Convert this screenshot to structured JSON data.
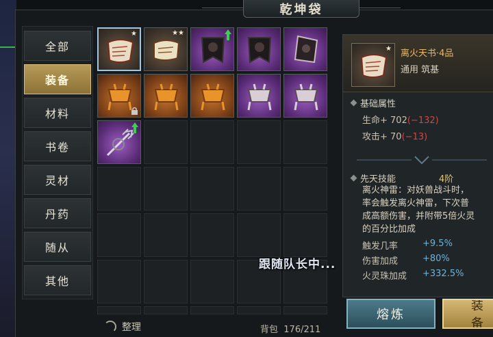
{
  "window": {
    "title": "乾坤袋"
  },
  "categories": [
    {
      "label": "全部",
      "active": false
    },
    {
      "label": "装备",
      "active": true
    },
    {
      "label": "材料",
      "active": false
    },
    {
      "label": "书卷",
      "active": false
    },
    {
      "label": "灵材",
      "active": false
    },
    {
      "label": "丹药",
      "active": false
    },
    {
      "label": "随从",
      "active": false
    },
    {
      "label": "其他",
      "active": false
    }
  ],
  "inventory": {
    "items": [
      {
        "name": "scroll",
        "quality": "white",
        "stars": "★",
        "selected": true
      },
      {
        "name": "scroll",
        "quality": "white",
        "stars": "★★"
      },
      {
        "name": "banner",
        "quality": "purple",
        "upgrade": true
      },
      {
        "name": "banner",
        "quality": "purple"
      },
      {
        "name": "shield-banner",
        "quality": "purple"
      },
      {
        "name": "cauldron",
        "quality": "orange",
        "locked": true
      },
      {
        "name": "cauldron",
        "quality": "orange"
      },
      {
        "name": "cauldron",
        "quality": "orange"
      },
      {
        "name": "cauldron",
        "quality": "purple"
      },
      {
        "name": "cauldron",
        "quality": "purple"
      },
      {
        "name": "trident",
        "quality": "purple",
        "upgrade": true
      }
    ],
    "tidy_label": "整理",
    "bag_label": "背包",
    "bag_count": "176/211"
  },
  "status": {
    "follow_text": "跟随队长中..."
  },
  "detail": {
    "name": "离火天书·4品",
    "subtitle": "通用 筑基",
    "base_title": "基础属性",
    "stats": [
      {
        "label": "生命",
        "value": "+ 702",
        "diff": "(−132)"
      },
      {
        "label": "攻击",
        "value": "+ 70",
        "diff": "(−13)"
      }
    ],
    "skill_title": "先天技能",
    "skill_level": "4阶",
    "skill_desc": "离火神雷：对妖兽战斗时，\n率会触发离火神雷，下次普\n成高额伤害，并附带5倍火灵\n的百分比加成",
    "effects": [
      {
        "label": "触发几率",
        "value": "+9.5%"
      },
      {
        "label": "伤害加成",
        "value": "+80%"
      },
      {
        "label": "火灵珠加成",
        "value": "+332.5%"
      }
    ]
  },
  "actions": {
    "smelt": "熔炼",
    "equip": "装备"
  },
  "colors": {
    "active_tab": "#b79a58",
    "negative": "#d4463f",
    "positive": "#6fb3d9",
    "item_name": "#e8b86a"
  }
}
